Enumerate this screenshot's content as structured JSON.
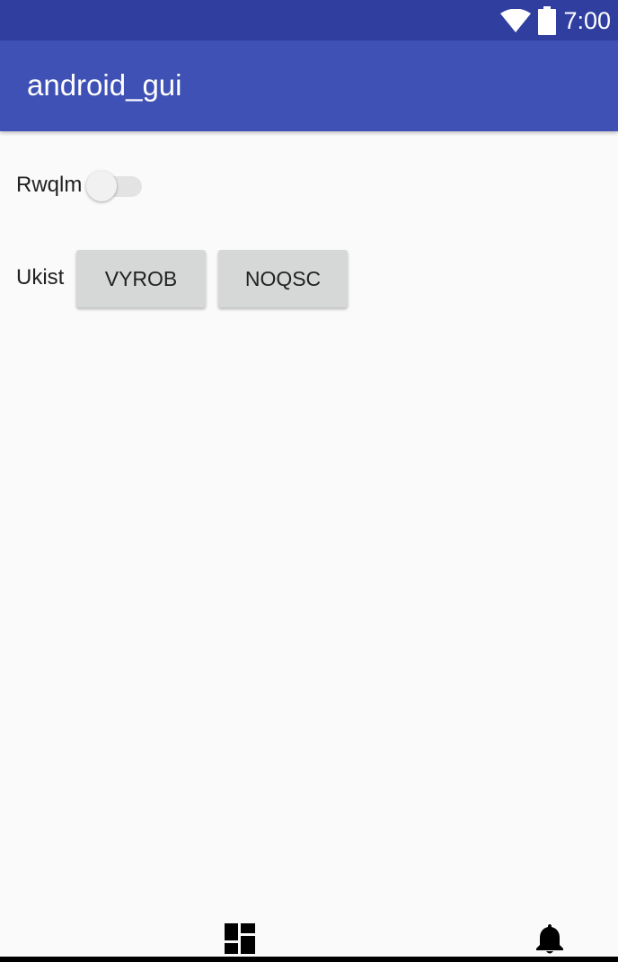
{
  "status_bar": {
    "time": "7:00",
    "icons": [
      "wifi-icon",
      "battery-icon"
    ],
    "background": "#303f9f"
  },
  "app_bar": {
    "title": "android_gui",
    "background": "#3f51b5"
  },
  "content": {
    "switch_row": {
      "label": "Rwqlm",
      "checked": false
    },
    "button_row": {
      "label": "Ukist",
      "buttons": [
        "VYROB",
        "NOQSC"
      ]
    }
  },
  "bottom_nav": {
    "icons": [
      "dashboard-icon",
      "bell-icon"
    ]
  }
}
